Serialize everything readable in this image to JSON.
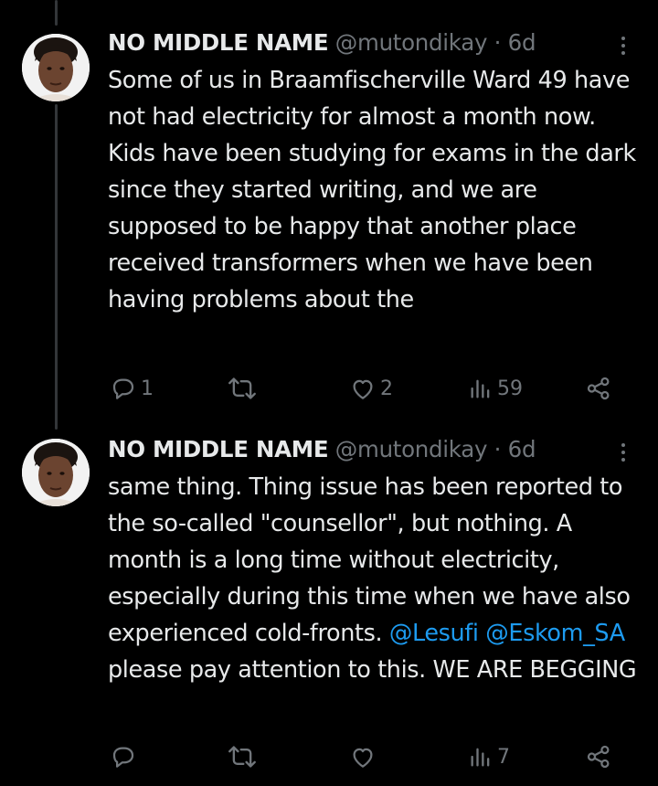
{
  "tweets": [
    {
      "author_name": "NO MIDDLE NAME",
      "handle": "@mutondikay",
      "separator": "·",
      "time": "6d",
      "text": "Some of us in Braamfischerville Ward 49 have not had electricity for almost a month now. Kids have been studying for exams in the dark since they started writing, and we are supposed to be happy that another place received transformers when we have been having problems about the",
      "replies": "1",
      "reposts": "",
      "likes": "2",
      "views": "59"
    },
    {
      "author_name": "NO MIDDLE NAME",
      "handle": "@mutondikay",
      "separator": "·",
      "time": "6d",
      "text_before_mentions": "same thing. Thing issue has been reported to the so-called \"counsellor\", but nothing. A month is a long time without electricity, especially during this time when we have also experienced cold-fronts.",
      "mention_1": "@Lesufi",
      "mention_2": "@Eskom_SA",
      "text_after_mentions": "please pay attention to this. WE ARE BEGGING",
      "replies": "",
      "reposts": "",
      "likes": "",
      "views": "7"
    }
  ],
  "icons": {
    "reply": "reply-icon",
    "repost": "repost-icon",
    "like": "heart-icon",
    "views": "views-icon",
    "share": "share-icon",
    "more": "more-options-icon"
  },
  "colors": {
    "background": "#000000",
    "text": "#e7e9ea",
    "secondary": "#71767b",
    "link": "#1d9bf0",
    "thread_line": "#333639"
  }
}
